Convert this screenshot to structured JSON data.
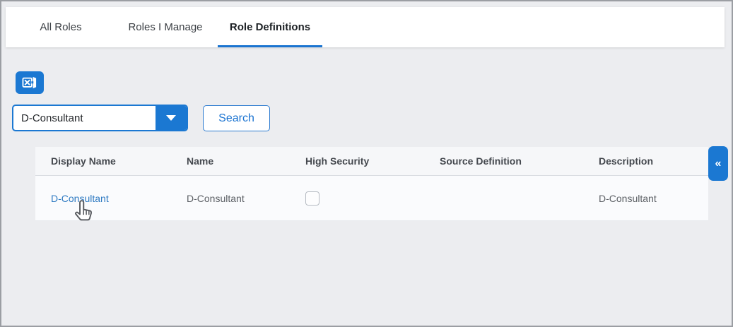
{
  "tabs": {
    "items": [
      {
        "label": "All Roles",
        "active": false
      },
      {
        "label": "Roles I Manage",
        "active": false
      },
      {
        "label": "Role Definitions",
        "active": true
      }
    ]
  },
  "toolbar": {
    "excel_icon": "excel-export-icon",
    "filter_dropdown": {
      "value": "D-Consultant"
    },
    "search_label": "Search"
  },
  "table": {
    "columns": [
      "Display Name",
      "Name",
      "High Security",
      "Source Definition",
      "Description"
    ],
    "rows": [
      {
        "display_name": "D-Consultant",
        "name": "D-Consultant",
        "high_security_checked": false,
        "source_definition": "",
        "description": "D-Consultant"
      }
    ]
  },
  "collapse_button": {
    "glyph": "«"
  },
  "colors": {
    "accent": "#1b78d2",
    "link": "#2e7ac2",
    "page_bg": "#ecedf0",
    "tab_underline": "#1b74d0"
  }
}
